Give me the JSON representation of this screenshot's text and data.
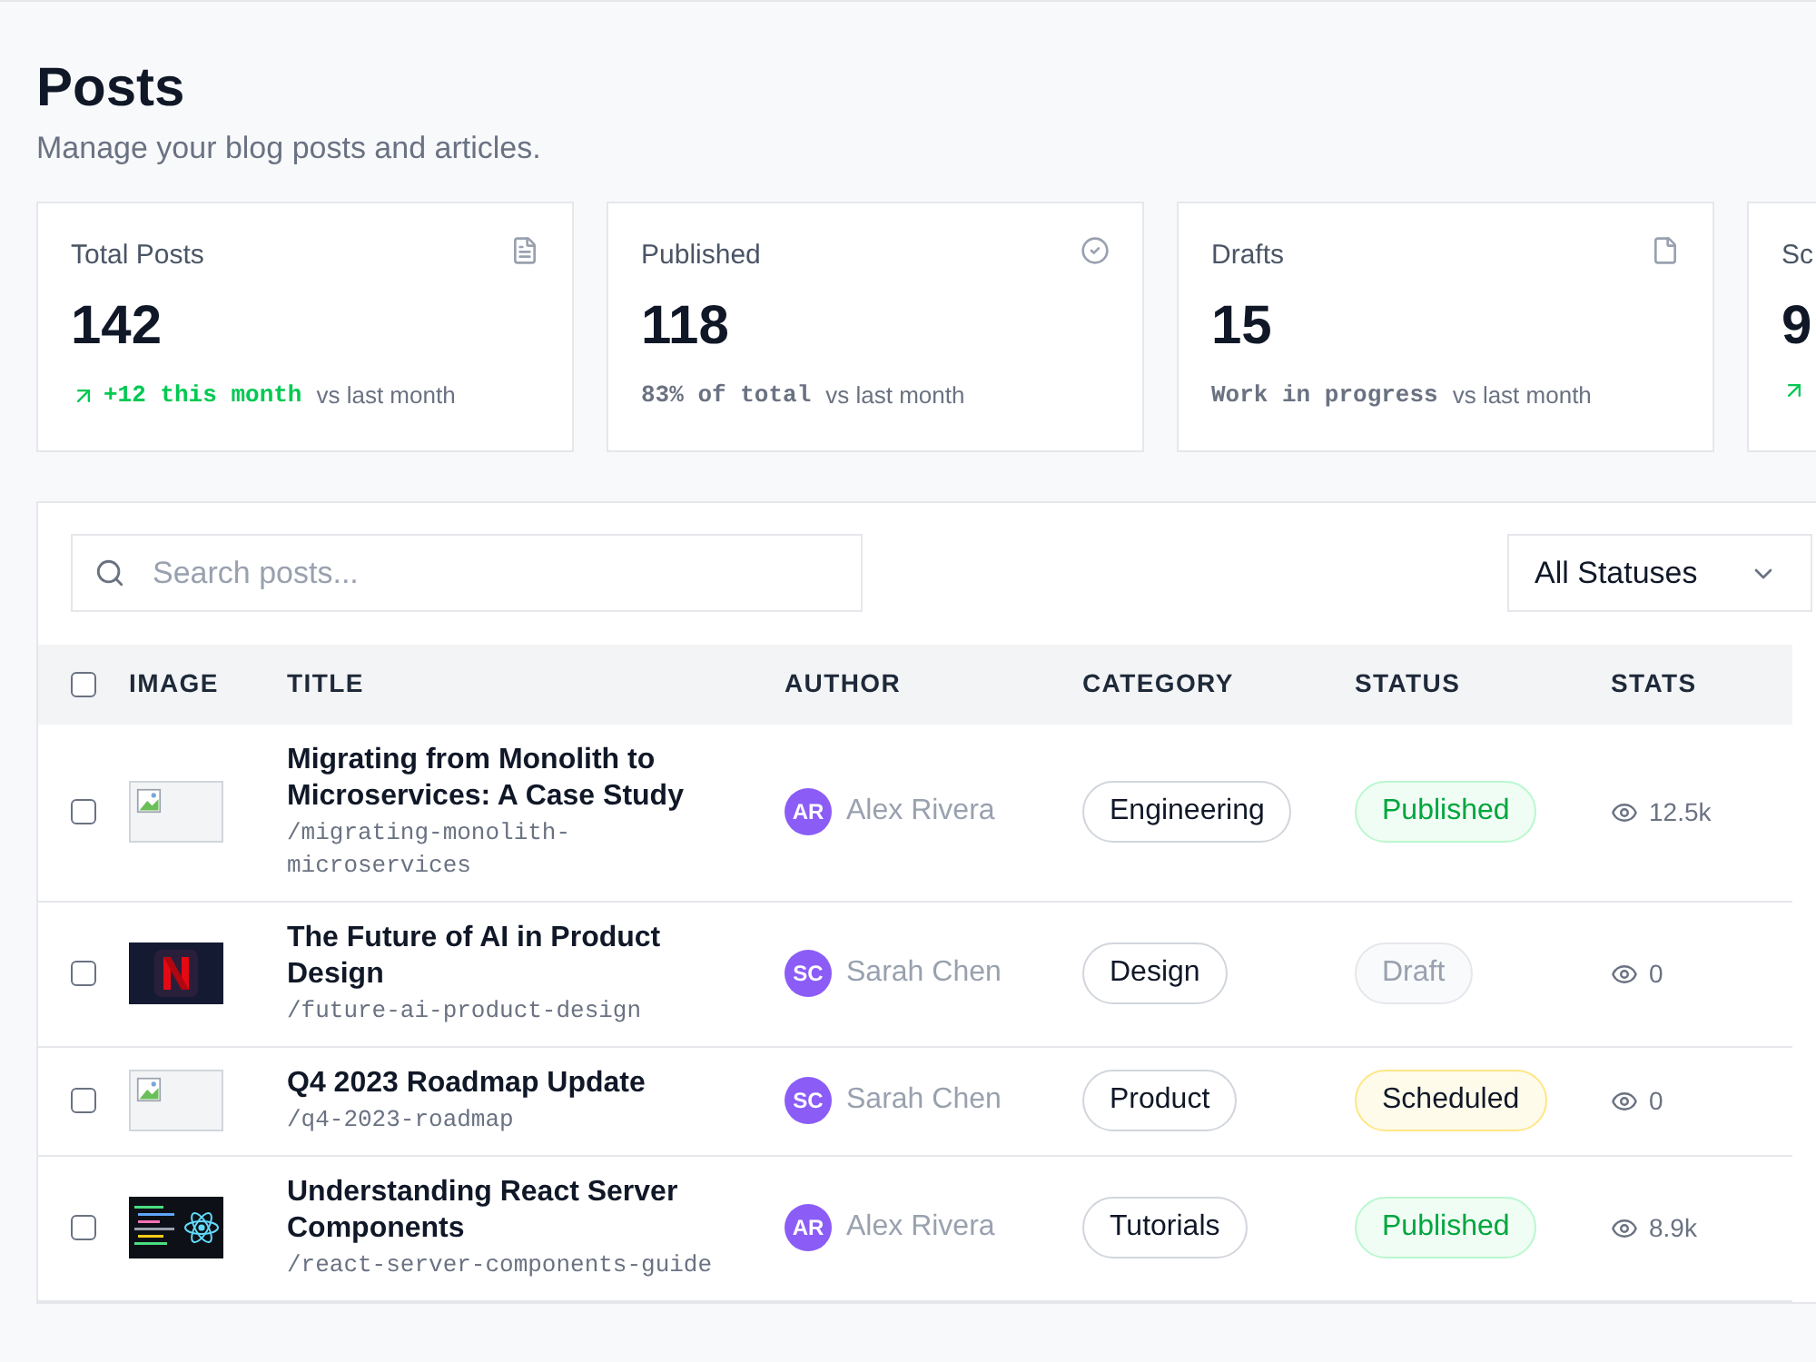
{
  "page": {
    "title": "Posts",
    "subtitle": "Manage your blog posts and articles."
  },
  "stats": [
    {
      "label": "Total Posts",
      "kind": "growth",
      "value": "142",
      "note": "+12 this month",
      "suffix": "vs last month"
    },
    {
      "label": "Published",
      "kind": "plain",
      "value": "118",
      "note": "83% of total",
      "suffix": "vs last month"
    },
    {
      "label": "Drafts",
      "kind": "plain",
      "value": "15",
      "note": "Work in progress",
      "suffix": "vs last month"
    },
    {
      "label": "Sc",
      "kind": "growth",
      "value": "9"
    }
  ],
  "search": {
    "placeholder": "Search posts..."
  },
  "filter": {
    "value": "All Statuses"
  },
  "table": {
    "select_all": {
      "checked": false
    },
    "columns": [
      "IMAGE",
      "TITLE",
      "AUTHOR",
      "CATEGORY",
      "STATUS",
      "STATS"
    ],
    "rows": [
      {
        "checked": false,
        "image": {
          "kind": "broken"
        },
        "title": "Migrating from Monolith to Microservices: A Case Study",
        "slug": "/migrating-monolith-microservices",
        "initials": "AR",
        "author": "Alex Rivera",
        "category": "Engineering",
        "status": {
          "text": "Published",
          "kind": "published"
        },
        "views": "12.5k"
      },
      {
        "checked": false,
        "title": "The Future of AI in Product Design",
        "slug": "/future-ai-product-design",
        "initials": "SC",
        "author": "Sarah Chen",
        "category": "Design",
        "status": {
          "text": "Draft",
          "kind": "draft"
        },
        "views": "0"
      },
      {
        "checked": false,
        "image": {
          "kind": "broken"
        },
        "title": "Q4 2023 Roadmap Update",
        "slug": "/q4-2023-roadmap",
        "initials": "SC",
        "author": "Sarah Chen",
        "category": "Product",
        "status": {
          "text": "Scheduled",
          "kind": "scheduled"
        },
        "views": "0"
      },
      {
        "checked": false,
        "image": {
          "kind": "screenshot"
        },
        "title": "Understanding React Server Components",
        "slug": "/react-server-components-guide",
        "initials": "AR",
        "author": "Alex Rivera",
        "category": "Tutorials",
        "status": {
          "text": "Published",
          "kind": "published"
        },
        "views": "8.9k"
      }
    ]
  }
}
